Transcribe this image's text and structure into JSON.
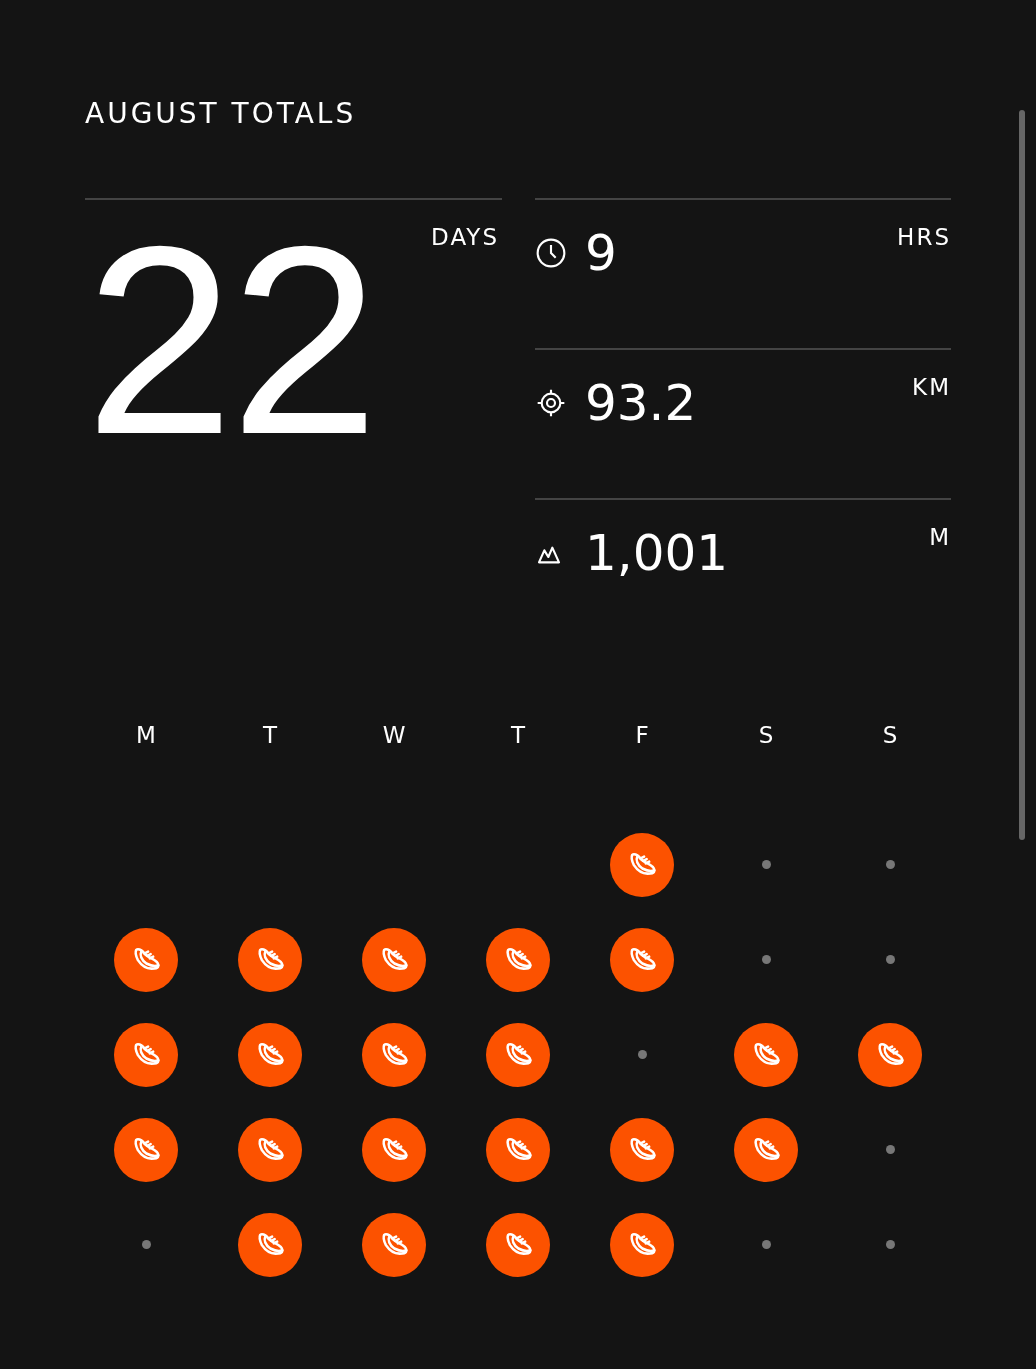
{
  "title": "AUGUST TOTALS",
  "days": {
    "value": "22",
    "unit": "DAYS"
  },
  "stats": [
    {
      "value": "9",
      "unit": "HRS"
    },
    {
      "value": "93.2",
      "unit": "KM"
    },
    {
      "value": "1,001",
      "unit": "M"
    }
  ],
  "weekdays": [
    "M",
    "T",
    "W",
    "T",
    "F",
    "S",
    "S"
  ],
  "weeks": [
    [
      {
        "kind": "blank"
      },
      {
        "kind": "blank"
      },
      {
        "kind": "blank"
      },
      {
        "kind": "blank"
      },
      {
        "kind": "run"
      },
      {
        "kind": "rest"
      },
      {
        "kind": "rest"
      }
    ],
    [
      {
        "kind": "run"
      },
      {
        "kind": "run"
      },
      {
        "kind": "run"
      },
      {
        "kind": "run"
      },
      {
        "kind": "run"
      },
      {
        "kind": "rest"
      },
      {
        "kind": "rest"
      }
    ],
    [
      {
        "kind": "run"
      },
      {
        "kind": "run"
      },
      {
        "kind": "run"
      },
      {
        "kind": "run"
      },
      {
        "kind": "rest"
      },
      {
        "kind": "run"
      },
      {
        "kind": "run"
      }
    ],
    [
      {
        "kind": "run"
      },
      {
        "kind": "run"
      },
      {
        "kind": "run"
      },
      {
        "kind": "run"
      },
      {
        "kind": "run"
      },
      {
        "kind": "run"
      },
      {
        "kind": "rest"
      }
    ],
    [
      {
        "kind": "rest"
      },
      {
        "kind": "run"
      },
      {
        "kind": "run"
      },
      {
        "kind": "run"
      },
      {
        "kind": "run"
      },
      {
        "kind": "rest"
      },
      {
        "kind": "rest"
      }
    ]
  ]
}
